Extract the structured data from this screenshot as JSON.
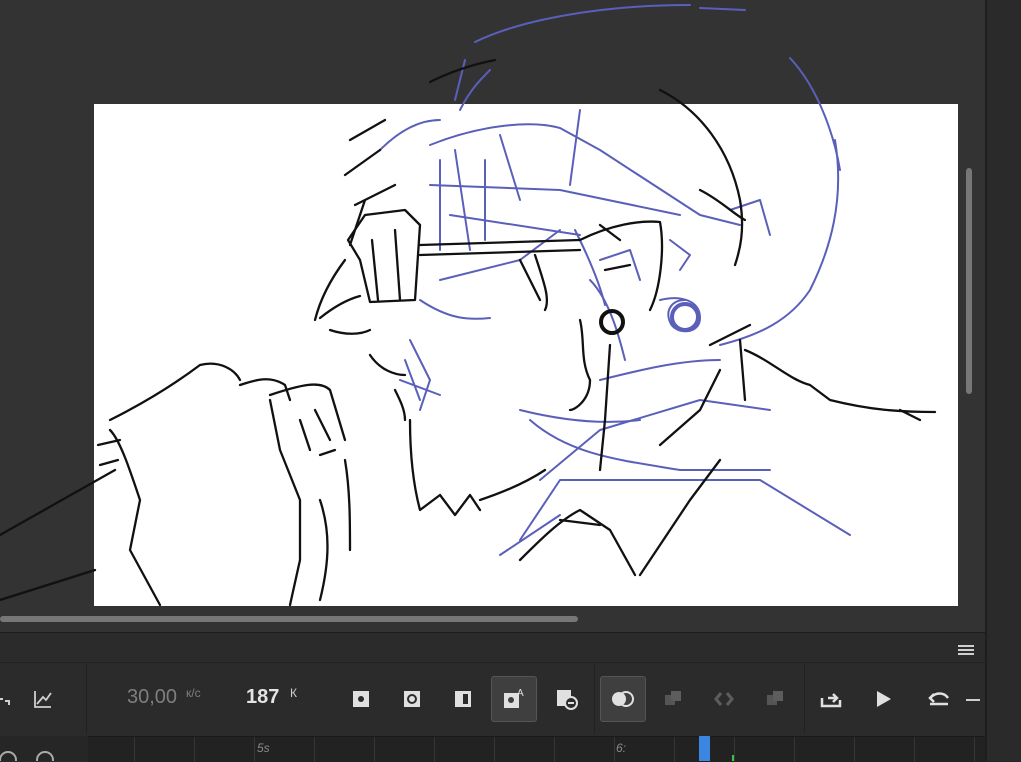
{
  "timeline": {
    "fps_value": "30,00",
    "fps_unit": "к/с",
    "frame_value": "187",
    "frame_unit": "К",
    "ruler_labels": [
      "5s",
      "6:"
    ]
  },
  "toolbar_icons": [
    "loop-icon",
    "graph-icon",
    "onion-off-icon",
    "onion-outline-icon",
    "onion-half-icon",
    "onion-auto-icon",
    "remove-frame-icon",
    "onion-skin-icon",
    "insert-frame-icon",
    "convert-icon",
    "insert-keyframe-icon",
    "go-end-icon",
    "play-icon",
    "undo-icon"
  ],
  "colors": {
    "stage": "#ffffff",
    "ink": "#111111",
    "sketch_blue": "#5a5fba",
    "accent_playhead": "#3b86e0",
    "workspace": "#333333"
  }
}
